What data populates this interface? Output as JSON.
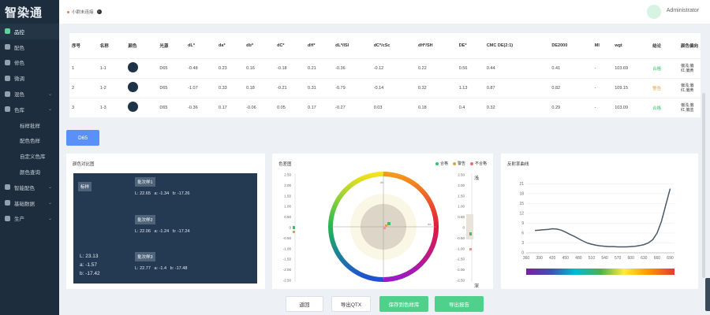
{
  "app": {
    "logo": "智染通"
  },
  "sidebar": {
    "items": [
      {
        "label": "品控",
        "icon": "quality-icon",
        "active": true,
        "expand": false
      },
      {
        "label": "配色",
        "icon": "palette-icon",
        "active": false,
        "expand": false
      },
      {
        "label": "修色",
        "icon": "repair-icon",
        "active": false,
        "expand": false
      },
      {
        "label": "微调",
        "icon": "tune-icon",
        "active": false,
        "expand": false
      },
      {
        "label": "混色",
        "icon": "mix-icon",
        "active": false,
        "expand": true
      },
      {
        "label": "色库",
        "icon": "library-icon",
        "active": false,
        "expand": true
      },
      {
        "label": "标样批样",
        "sub": true
      },
      {
        "label": "配色色样",
        "sub": true
      },
      {
        "label": "自定义色库",
        "sub": true
      },
      {
        "label": "颜色查询",
        "sub": true
      },
      {
        "label": "智能配色",
        "icon": "smart-icon",
        "active": false,
        "expand": true
      },
      {
        "label": "基础数据",
        "icon": "data-icon",
        "active": false,
        "expand": true
      },
      {
        "label": "生产",
        "icon": "production-icon",
        "active": false,
        "expand": true
      }
    ]
  },
  "header": {
    "device_status": "小尉未连接",
    "user": "Administrator"
  },
  "table": {
    "headers": [
      "序号",
      "名称",
      "颜色",
      "光源",
      "dL*",
      "da*",
      "db*",
      "dC*",
      "dH*",
      "dL*/lSl",
      "dC*/cSc",
      "dH*/SH",
      "DE*",
      "CMC DE(2:1)",
      "DE2000",
      "MI",
      "wgt",
      "结论",
      "颜色偏向"
    ],
    "rows": [
      [
        "1",
        "1-1",
        "",
        "D65",
        "-0.48",
        "0.23",
        "0.16",
        "-0.18",
        "0.21",
        "-0.36",
        "-0.12",
        "0.22",
        "0.56",
        "0.44",
        "0.41",
        "-",
        "103.69",
        "合格",
        "偏浅,偏红,偏黄"
      ],
      [
        "2",
        "1-2",
        "",
        "D65",
        "-1.07",
        "0.33",
        "0.18",
        "-0.21",
        "0.31",
        "-0.79",
        "-0.14",
        "0.32",
        "1.13",
        "0.87",
        "0.82",
        "-",
        "109.15",
        "警告",
        "偏浅,偏红,偏黄"
      ],
      [
        "3",
        "1-3",
        "",
        "D65",
        "-0.36",
        "0.17",
        "-0.06",
        "0.05",
        "0.17",
        "-0.27",
        "0.03",
        "0.18",
        "0.4",
        "0.32",
        "0.29",
        "-",
        "103.09",
        "合格",
        "偏浅,偏红,偏蓝"
      ]
    ],
    "status_colors": {
      "合格": "#35c26a",
      "警告": "#e6a23c"
    },
    "swatch_color": "#1f3347"
  },
  "tab": {
    "label": "D65"
  },
  "compare": {
    "title": "颜色对比图",
    "standard_label": "标样",
    "batches": [
      {
        "label": "批次样1",
        "L": "L: 22.65",
        "a": "a: -1.34",
        "b": "b: -17.26"
      },
      {
        "label": "批次样2",
        "L": "L: 22.06",
        "a": "a: -1.24",
        "b": "b: -17.24"
      },
      {
        "label": "批次样3",
        "L": "L: 22.77",
        "a": "a: -1.4",
        "b": "b: -17.48"
      }
    ],
    "standard": {
      "L": "L:  23.13",
      "a": "a:  -1.57",
      "b": "b:  -17.42"
    }
  },
  "colordiff": {
    "title": "色差图",
    "legend": [
      {
        "label": "合格",
        "color": "#35c26a"
      },
      {
        "label": "警告",
        "color": "#e6a23c"
      },
      {
        "label": "不合格",
        "color": "#f56c6c"
      }
    ],
    "left_ticks": [
      "2.50",
      "2.00",
      "1.50",
      "1.00",
      "0.50",
      "0",
      "-0.50",
      "-1.00",
      "-1.50",
      "-2.00",
      "-2.50"
    ],
    "right_ticks": [
      "2.50",
      "2.00",
      "1.50",
      "1.00",
      "0.50",
      "0",
      "-0.50",
      "-1.00",
      "-1.50",
      "-2.00",
      "-2.50"
    ],
    "top_label": "浅",
    "bottom_label": "深",
    "axis_top": "db",
    "axis_right": "da",
    "axis_left": "da",
    "axis_bottom": "db"
  },
  "reflect": {
    "title": "反射率曲线"
  },
  "chart_data": {
    "type": "line",
    "title": "反射率曲线",
    "x": [
      380,
      390,
      400,
      410,
      420,
      430,
      440,
      450,
      460,
      470,
      480,
      490,
      500,
      510,
      520,
      530,
      540,
      550,
      560,
      570,
      580,
      590,
      600,
      610,
      620,
      630,
      640,
      650,
      660,
      670,
      680,
      690
    ],
    "series": [
      {
        "values": [
          6.8,
          6.9,
          7.0,
          7.1,
          7.3,
          7.2,
          6.9,
          6.3,
          5.6,
          5.0,
          4.3,
          3.6,
          3.0,
          2.6,
          2.3,
          2.1,
          2.0,
          1.9,
          1.9,
          1.8,
          1.8,
          1.8,
          1.9,
          2.0,
          2.2,
          2.5,
          3.0,
          4.0,
          6.0,
          9.5,
          14.5,
          19.5
        ]
      }
    ],
    "xticks": [
      "360",
      "390",
      "420",
      "450",
      "480",
      "510",
      "540",
      "570",
      "600",
      "630",
      "660",
      "690"
    ],
    "yticks": [
      "0",
      "3",
      "6",
      "9",
      "12",
      "15",
      "18",
      "21"
    ],
    "xlim": [
      360,
      700
    ],
    "ylim": [
      0,
      23
    ]
  },
  "buttons": {
    "back": "返回",
    "export_qtx": "导出QTX",
    "save": "保存到色样库",
    "report": "导出报告"
  }
}
